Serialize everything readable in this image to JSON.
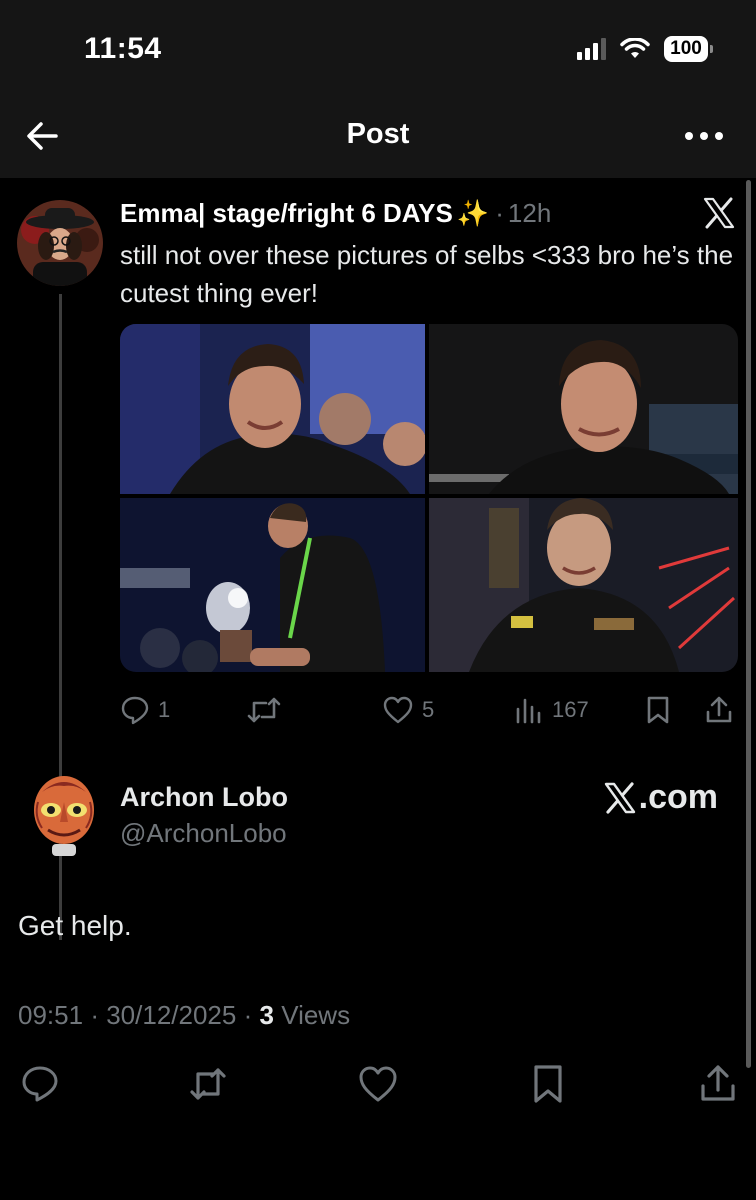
{
  "status_bar": {
    "time": "11:54",
    "battery": "100"
  },
  "nav": {
    "title": "Post",
    "back_icon": "back-arrow-icon",
    "more_icon": "more-icon"
  },
  "quoted_post": {
    "name": "Emma| stage/fright 6 DAYS",
    "name_emoji": "✨",
    "separator": "·",
    "time": "12h",
    "text": "still not over these pictures of selbs <333 bro he’s the cutest thing ever!",
    "stats": {
      "replies": "1",
      "likes": "5",
      "views": "167"
    }
  },
  "reply_post": {
    "name": "Archon Lobo",
    "handle": "@ArchonLobo",
    "watermark": ".com",
    "text": "Get help.",
    "time": "09:51",
    "sep1": "·",
    "date": "30/12/2025",
    "sep2": "·",
    "views_count": "3",
    "views_label": "Views"
  },
  "colors": {
    "background": "#000000",
    "bar": "#151515",
    "text": "#e7e9ea",
    "muted": "#71767b"
  }
}
